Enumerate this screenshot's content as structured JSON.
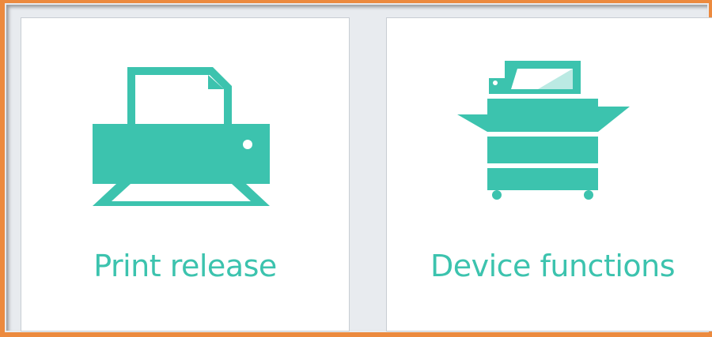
{
  "colors": {
    "accent": "#3cc3ae",
    "frame_border": "#ec8a3e",
    "background": "#e8ebef",
    "tile": "#ffffff"
  },
  "tiles": [
    {
      "id": "print-release",
      "label": "Print release",
      "icon": "printer-icon"
    },
    {
      "id": "device-functions",
      "label": "Device functions",
      "icon": "copier-icon"
    }
  ]
}
